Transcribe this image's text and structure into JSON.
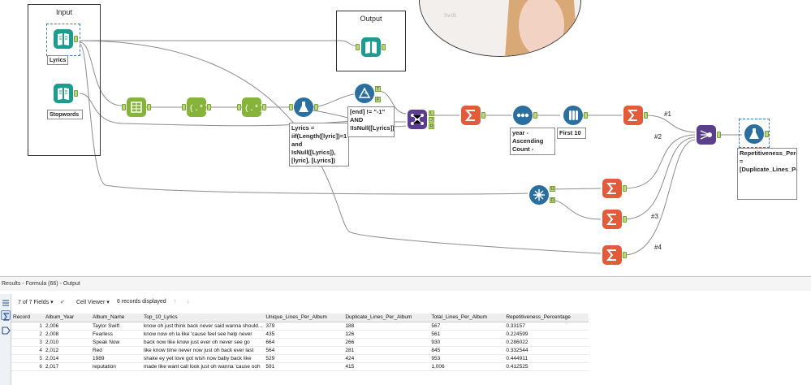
{
  "canvas": {
    "input_container_title": "Input",
    "output_container_title": "Output",
    "lyrics_tool_label": "Lyrics",
    "stopwords_tool_label": "Stopwords",
    "formula_annotation": "Lyrics = iif(Length([lyric])=1 and IsNull([Lyrics]), [lyric], [Lyrics]) Lyrics =...",
    "filter_annotation": "[end] != \"-1\" AND !IsNull([Lyrics])",
    "sort_annotation": "year - Ascending Count - Descending",
    "sample_annotation": "First 10",
    "final_formula_annotation": "Repetitiveness_Percentage = [Duplicate_Lines_Per_Album]/[Total_Lines_Per_Album]",
    "wire_labels": [
      "#1",
      "#2",
      "#3",
      "#4"
    ],
    "filter_anchors": [
      "T",
      "F"
    ],
    "join_anchors": [
      "L",
      "J",
      "R"
    ],
    "unique_anchors": [
      "U",
      "D"
    ]
  },
  "results": {
    "title": "Results - Formula (66) - Output",
    "fields_label": "7 of 7 Fields",
    "viewer_label": "Cell Viewer",
    "records_label": "6 records displayed",
    "columns": [
      "Record",
      "Album_Year",
      "Album_Name",
      "Top_10_Lyrics",
      "Unique_Lines_Per_Album",
      "Duplicate_Lines_Per_Album",
      "Total_Lines_Per_Album",
      "Repetitiveness_Percentage"
    ],
    "rows": [
      [
        "1",
        "2,006",
        "Taylor Swift",
        "know oh just think back never said wanna should...",
        "379",
        "188",
        "567",
        "0.33157"
      ],
      [
        "2",
        "2,008",
        "Fearless",
        "know now oh la like 'cause feel see help never",
        "435",
        "126",
        "561",
        "0.224599"
      ],
      [
        "3",
        "2,010",
        "Speak Now",
        "back now like know just ever oh never see go",
        "664",
        "266",
        "930",
        "0.286022"
      ],
      [
        "4",
        "2,012",
        "Red",
        "like know time never now just oh back ever last",
        "564",
        "281",
        "845",
        "0.332544"
      ],
      [
        "5",
        "2,014",
        "1989",
        "shake ey yet love got wish now baby back like",
        "529",
        "424",
        "953",
        "0.444911"
      ],
      [
        "6",
        "2,017",
        "reputation",
        "made like want call look just oh wanna 'cause ooh",
        "591",
        "415",
        "1,006",
        "0.412525"
      ]
    ]
  },
  "colors": {
    "teal_tool": "#1b9c8e",
    "green_tool": "#86b43a",
    "blue_tool": "#2a6fa0",
    "orange_tool": "#e25b3b",
    "purple_tool": "#5b3f8e",
    "wire": "#8d8d8d"
  }
}
